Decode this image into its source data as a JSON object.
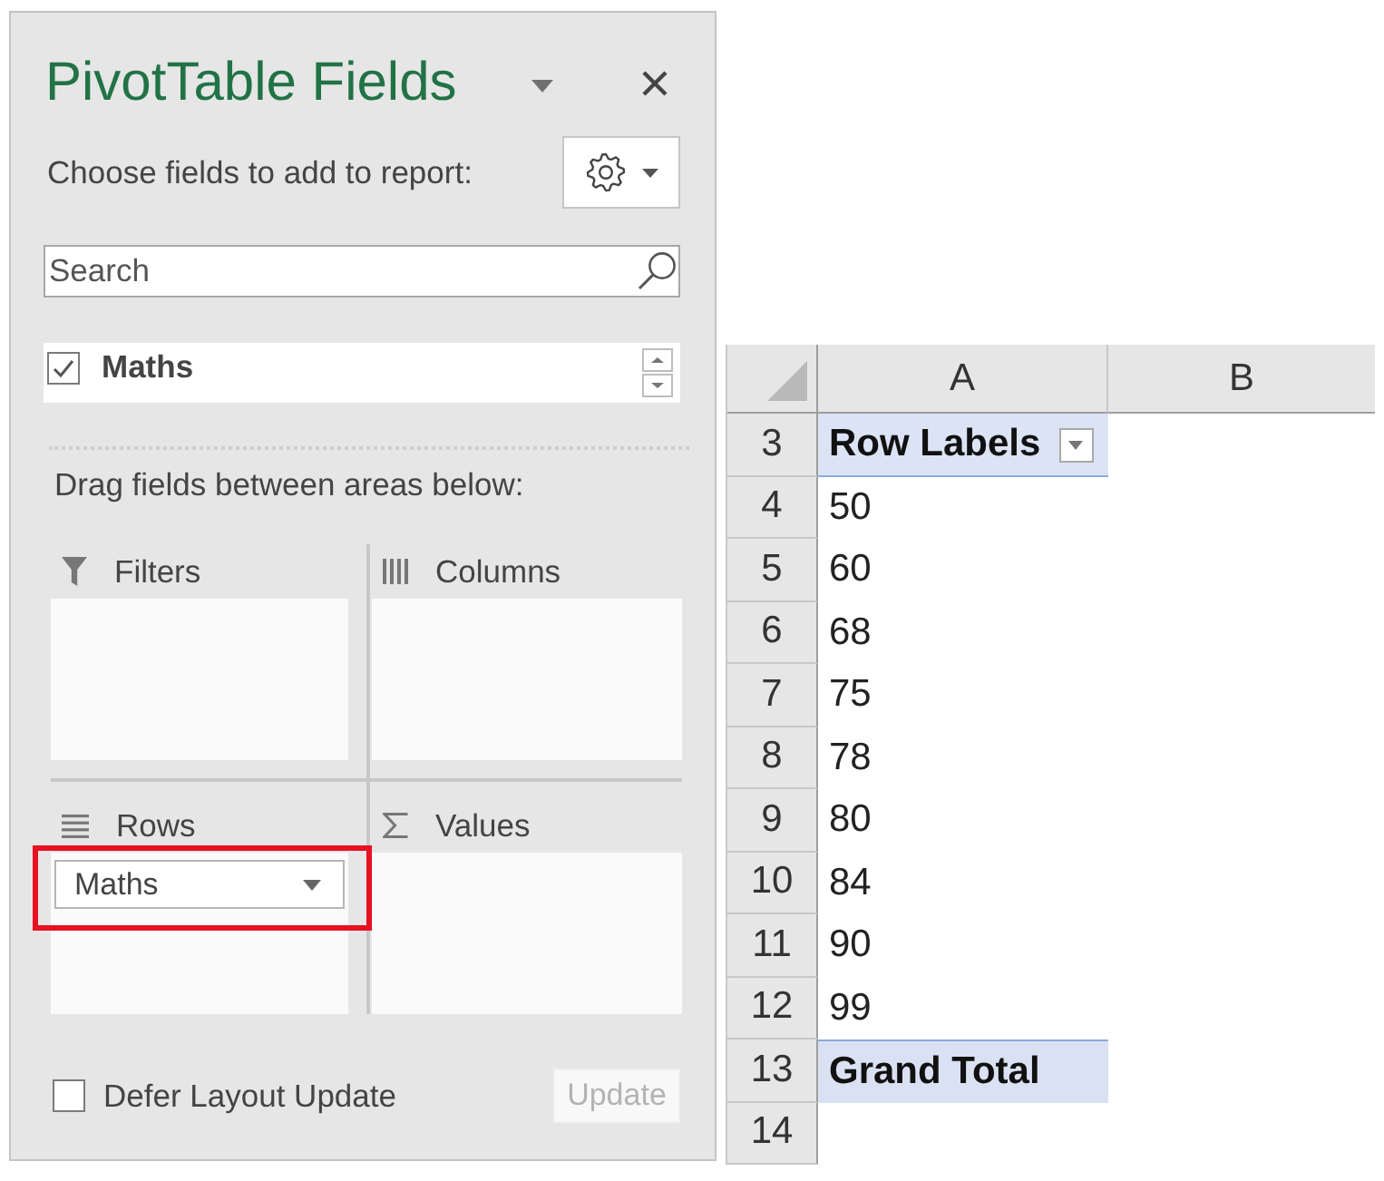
{
  "panel": {
    "title": "PivotTable Fields",
    "prompt": "Choose fields to add to report:",
    "search": {
      "placeholder": "Search"
    },
    "fields": [
      {
        "label": "Maths",
        "checked": true
      }
    ],
    "areas_hint": "Drag fields between areas below:",
    "areas": [
      {
        "kind": "filters",
        "label": "Filters"
      },
      {
        "kind": "columns",
        "label": "Columns"
      },
      {
        "kind": "rows",
        "label": "Rows",
        "items": [
          {
            "label": "Maths",
            "highlighted": true
          }
        ]
      },
      {
        "kind": "values",
        "label": "Values"
      }
    ],
    "defer_update": {
      "label": "Defer Layout Update",
      "checked": false
    },
    "update_button": {
      "label": "Update",
      "disabled": true
    }
  },
  "sheet": {
    "columns": [
      "A",
      "B"
    ],
    "rows": [
      {
        "number": "3",
        "kind": "header",
        "value": "Row Labels",
        "filter_button": true
      },
      {
        "number": "4",
        "kind": "item",
        "value": "50"
      },
      {
        "number": "5",
        "kind": "item",
        "value": "60"
      },
      {
        "number": "6",
        "kind": "item",
        "value": "68"
      },
      {
        "number": "7",
        "kind": "item",
        "value": "75"
      },
      {
        "number": "8",
        "kind": "item",
        "value": "78"
      },
      {
        "number": "9",
        "kind": "item",
        "value": "80"
      },
      {
        "number": "10",
        "kind": "item",
        "value": "84"
      },
      {
        "number": "11",
        "kind": "item",
        "value": "90"
      },
      {
        "number": "12",
        "kind": "item",
        "value": "99"
      },
      {
        "number": "13",
        "kind": "total",
        "value": "Grand Total"
      },
      {
        "number": "14",
        "kind": "item"
      }
    ]
  }
}
